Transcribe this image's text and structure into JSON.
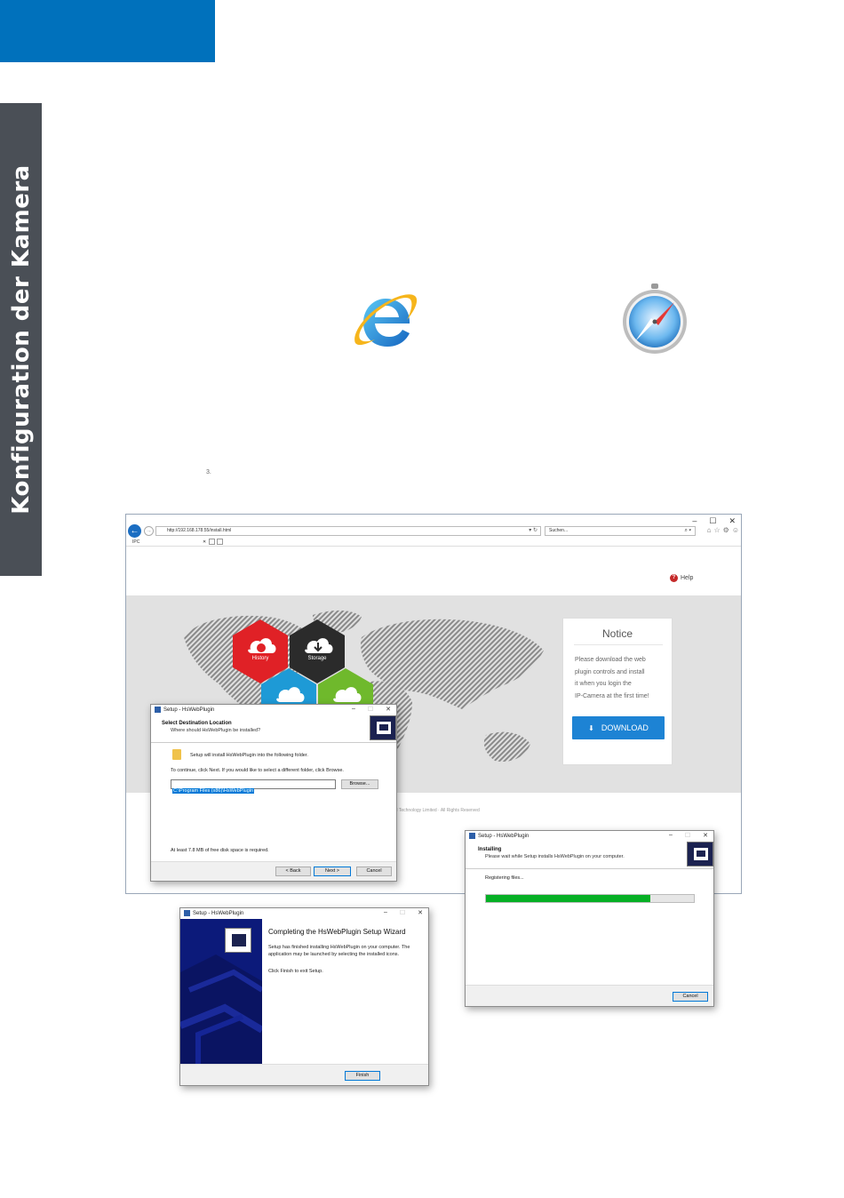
{
  "section_tab": {
    "label": "Konfiguration der Kamera"
  },
  "step": {
    "number": "3."
  },
  "browser": {
    "url": "http://192.168.178.55/install.html",
    "search_placeholder": "Suchen...",
    "tab_label": "IPC",
    "help_label": "Help",
    "tiles": {
      "history": "History",
      "storage": "Storage"
    },
    "notice": {
      "title": "Notice",
      "lines": [
        "Please download the web",
        "plugin controls and install",
        "it when you login the",
        "IP-Camera at the first time!"
      ],
      "download_label": "DOWNLOAD"
    },
    "footer_text": "nd Technology Limited · All Rights Reserved"
  },
  "dialog_destination": {
    "title": "Setup - HsWebPlugin",
    "heading": "Select Destination Location",
    "subheading": "Where should HsWebPlugin be installed?",
    "line1": "Setup will install HsWebPlugin into the following folder.",
    "line2": "To continue, click Next. If you would like to select a different folder, click Browse.",
    "path_value": "C:\\Program Files (x86)\\HsWebPlugin",
    "browse_label": "Browse...",
    "disk_space": "At least 7.8 MB of free disk space is required.",
    "back_label": "< Back",
    "next_label": "Next >",
    "cancel_label": "Cancel"
  },
  "dialog_installing": {
    "title": "Setup - HsWebPlugin",
    "heading": "Installing",
    "subheading": "Please wait while Setup installs HsWebPlugin on your computer.",
    "status": "Registering files...",
    "progress": 0.79,
    "cancel_label": "Cancel"
  },
  "dialog_complete": {
    "title": "Setup - HsWebPlugin",
    "heading": "Completing the HsWebPlugin Setup Wizard",
    "body": "Setup has finished installing HsWebPlugin on your computer. The application may be launched by selecting the installed icons.",
    "exit_text": "Click Finish to exit Setup.",
    "finish_label": "Finish"
  },
  "colors": {
    "brand_blue": "#0071bc",
    "side_tab": "#4a4f56",
    "download_button": "#1d83d4",
    "progress": "#06b025",
    "tile_history": "#e02126",
    "tile_storage": "#2b2b2b",
    "tile_share": "#1e9ad6",
    "tile_video": "#6fb92c"
  }
}
